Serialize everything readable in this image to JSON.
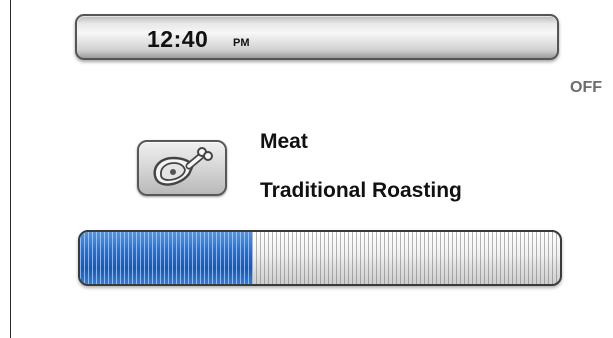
{
  "clock": {
    "time": "12:40",
    "ampm": "PM"
  },
  "power": {
    "status": "OFF"
  },
  "cooking": {
    "food_icon": "meat-drumstick-icon",
    "food_category": "Meat",
    "program": "Traditional Roasting",
    "progress_fraction": 0.36
  },
  "colors": {
    "progress_fill": "#2f6fc4",
    "status_text": "#6d6d6d"
  }
}
